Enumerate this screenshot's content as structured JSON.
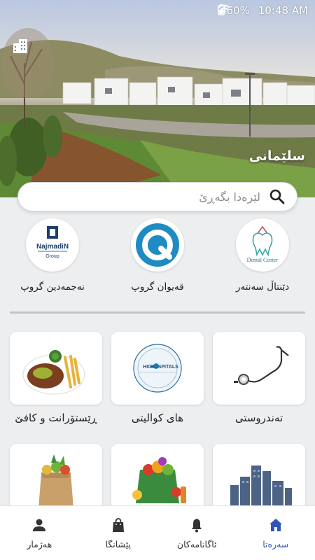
{
  "status_bar": {
    "battery": "60%",
    "time": "10:48 AM"
  },
  "hero": {
    "city_name": "سلێمانی"
  },
  "search": {
    "placeholder": "لێرەدا بگەڕێ"
  },
  "featured": [
    {
      "label": "دێنتاڵ سەنتەر",
      "logo_text": "Dental Center",
      "icon": "dental-center-logo"
    },
    {
      "label": "قەیوان گروپ",
      "logo_text": "Q",
      "icon": "qaiwan-group-logo"
    },
    {
      "label": "نەجمەدین گروپ",
      "logo_text": "NajmadiN",
      "logo_sub": "Group",
      "icon": "najmadin-group-logo"
    }
  ],
  "categories": [
    {
      "label": "تەندروستی",
      "icon": "stethoscope-icon"
    },
    {
      "label": "های کوالیتی",
      "logo_text": "HIGH",
      "logo_text2": "HOSPITALS",
      "icon": "high-q-hospitals-logo"
    },
    {
      "label": "ڕێستۆرانت و کافێ",
      "icon": "steak-dish-icon"
    },
    {
      "label": "",
      "icon": "city-buildings-icon"
    },
    {
      "label": "",
      "icon": "vegetables-bags-icon"
    },
    {
      "label": "",
      "icon": "grocery-bag-icon"
    }
  ],
  "nav": [
    {
      "label": "سەرەتا",
      "icon": "home-icon",
      "active": true
    },
    {
      "label": "ئاگانامەکان",
      "icon": "bell-icon",
      "active": false
    },
    {
      "label": "پێشانگا",
      "icon": "shopping-bag-icon",
      "active": false
    },
    {
      "label": "هەژمار",
      "icon": "account-icon",
      "active": false
    }
  ],
  "colors": {
    "accent": "#2f55b8",
    "background": "#eceef0"
  }
}
